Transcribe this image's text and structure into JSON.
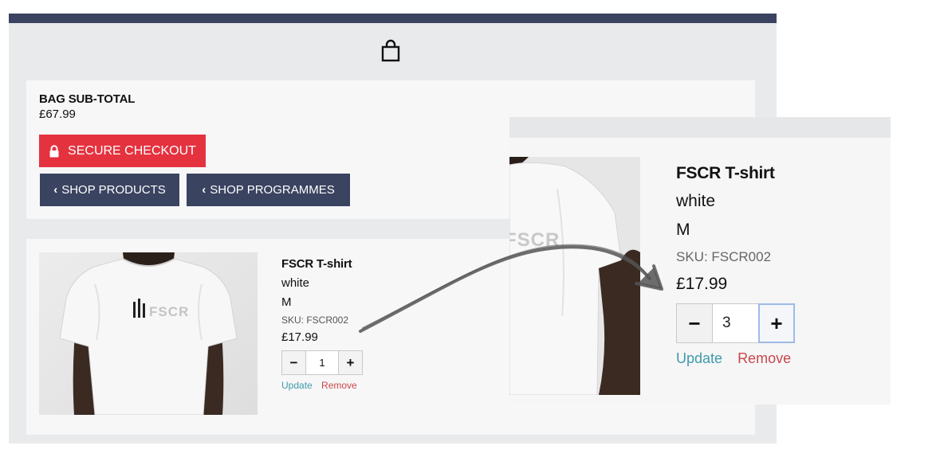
{
  "header": {
    "icon": "shopping-bag-icon"
  },
  "summary": {
    "subtotal_label": "BAG SUB-TOTAL",
    "subtotal_value": "£67.99",
    "checkout_label": "SECURE CHECKOUT",
    "shop_products_label": "SHOP PRODUCTS",
    "shop_programmes_label": "SHOP PROGRAMMES"
  },
  "item": {
    "name": "FSCR T-shirt",
    "color": "white",
    "size": "M",
    "sku": "SKU: FSCR002",
    "price": "£17.99",
    "quantity": "1",
    "update_label": "Update",
    "remove_label": "Remove",
    "logo_text": "FSCR"
  },
  "zoom": {
    "name": "FSCR T-shirt",
    "color": "white",
    "size": "M",
    "sku": "SKU: FSCR002",
    "price": "£17.99",
    "quantity": "3",
    "update_label": "Update",
    "remove_label": "Remove",
    "logo_text": "FSCR"
  },
  "colors": {
    "navy": "#3a4360",
    "checkout_red": "#e5323f",
    "update_link": "#3f9aab",
    "remove_link": "#c9474b",
    "focus_ring": "#9dbbe6"
  }
}
